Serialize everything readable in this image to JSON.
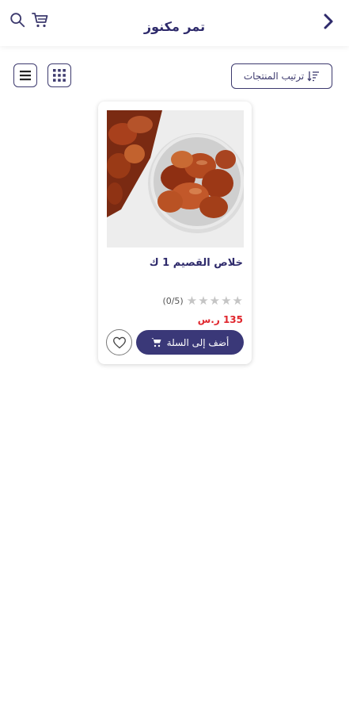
{
  "header": {
    "title": "تمر مكنوز",
    "icons": {
      "search": "search-icon",
      "cart": "cart-icon",
      "back": "chevron-right-icon"
    }
  },
  "toolbar": {
    "sort_label": "ترتيب المنتجات",
    "icons": {
      "sort": "sort-icon",
      "list": "list-view-icon",
      "grid": "grid-view-icon"
    }
  },
  "products": [
    {
      "name": "خلاص القصيم 1 ك",
      "rating_count": "(0/5)",
      "price": "135 ر.س",
      "add_to_cart_label": "أضف إلى السلة",
      "stars_filled": 0
    }
  ],
  "colors": {
    "primary": "#3a3878",
    "title": "#2e2a6b",
    "price": "#e0262d",
    "star_empty": "#c5c5c5"
  }
}
